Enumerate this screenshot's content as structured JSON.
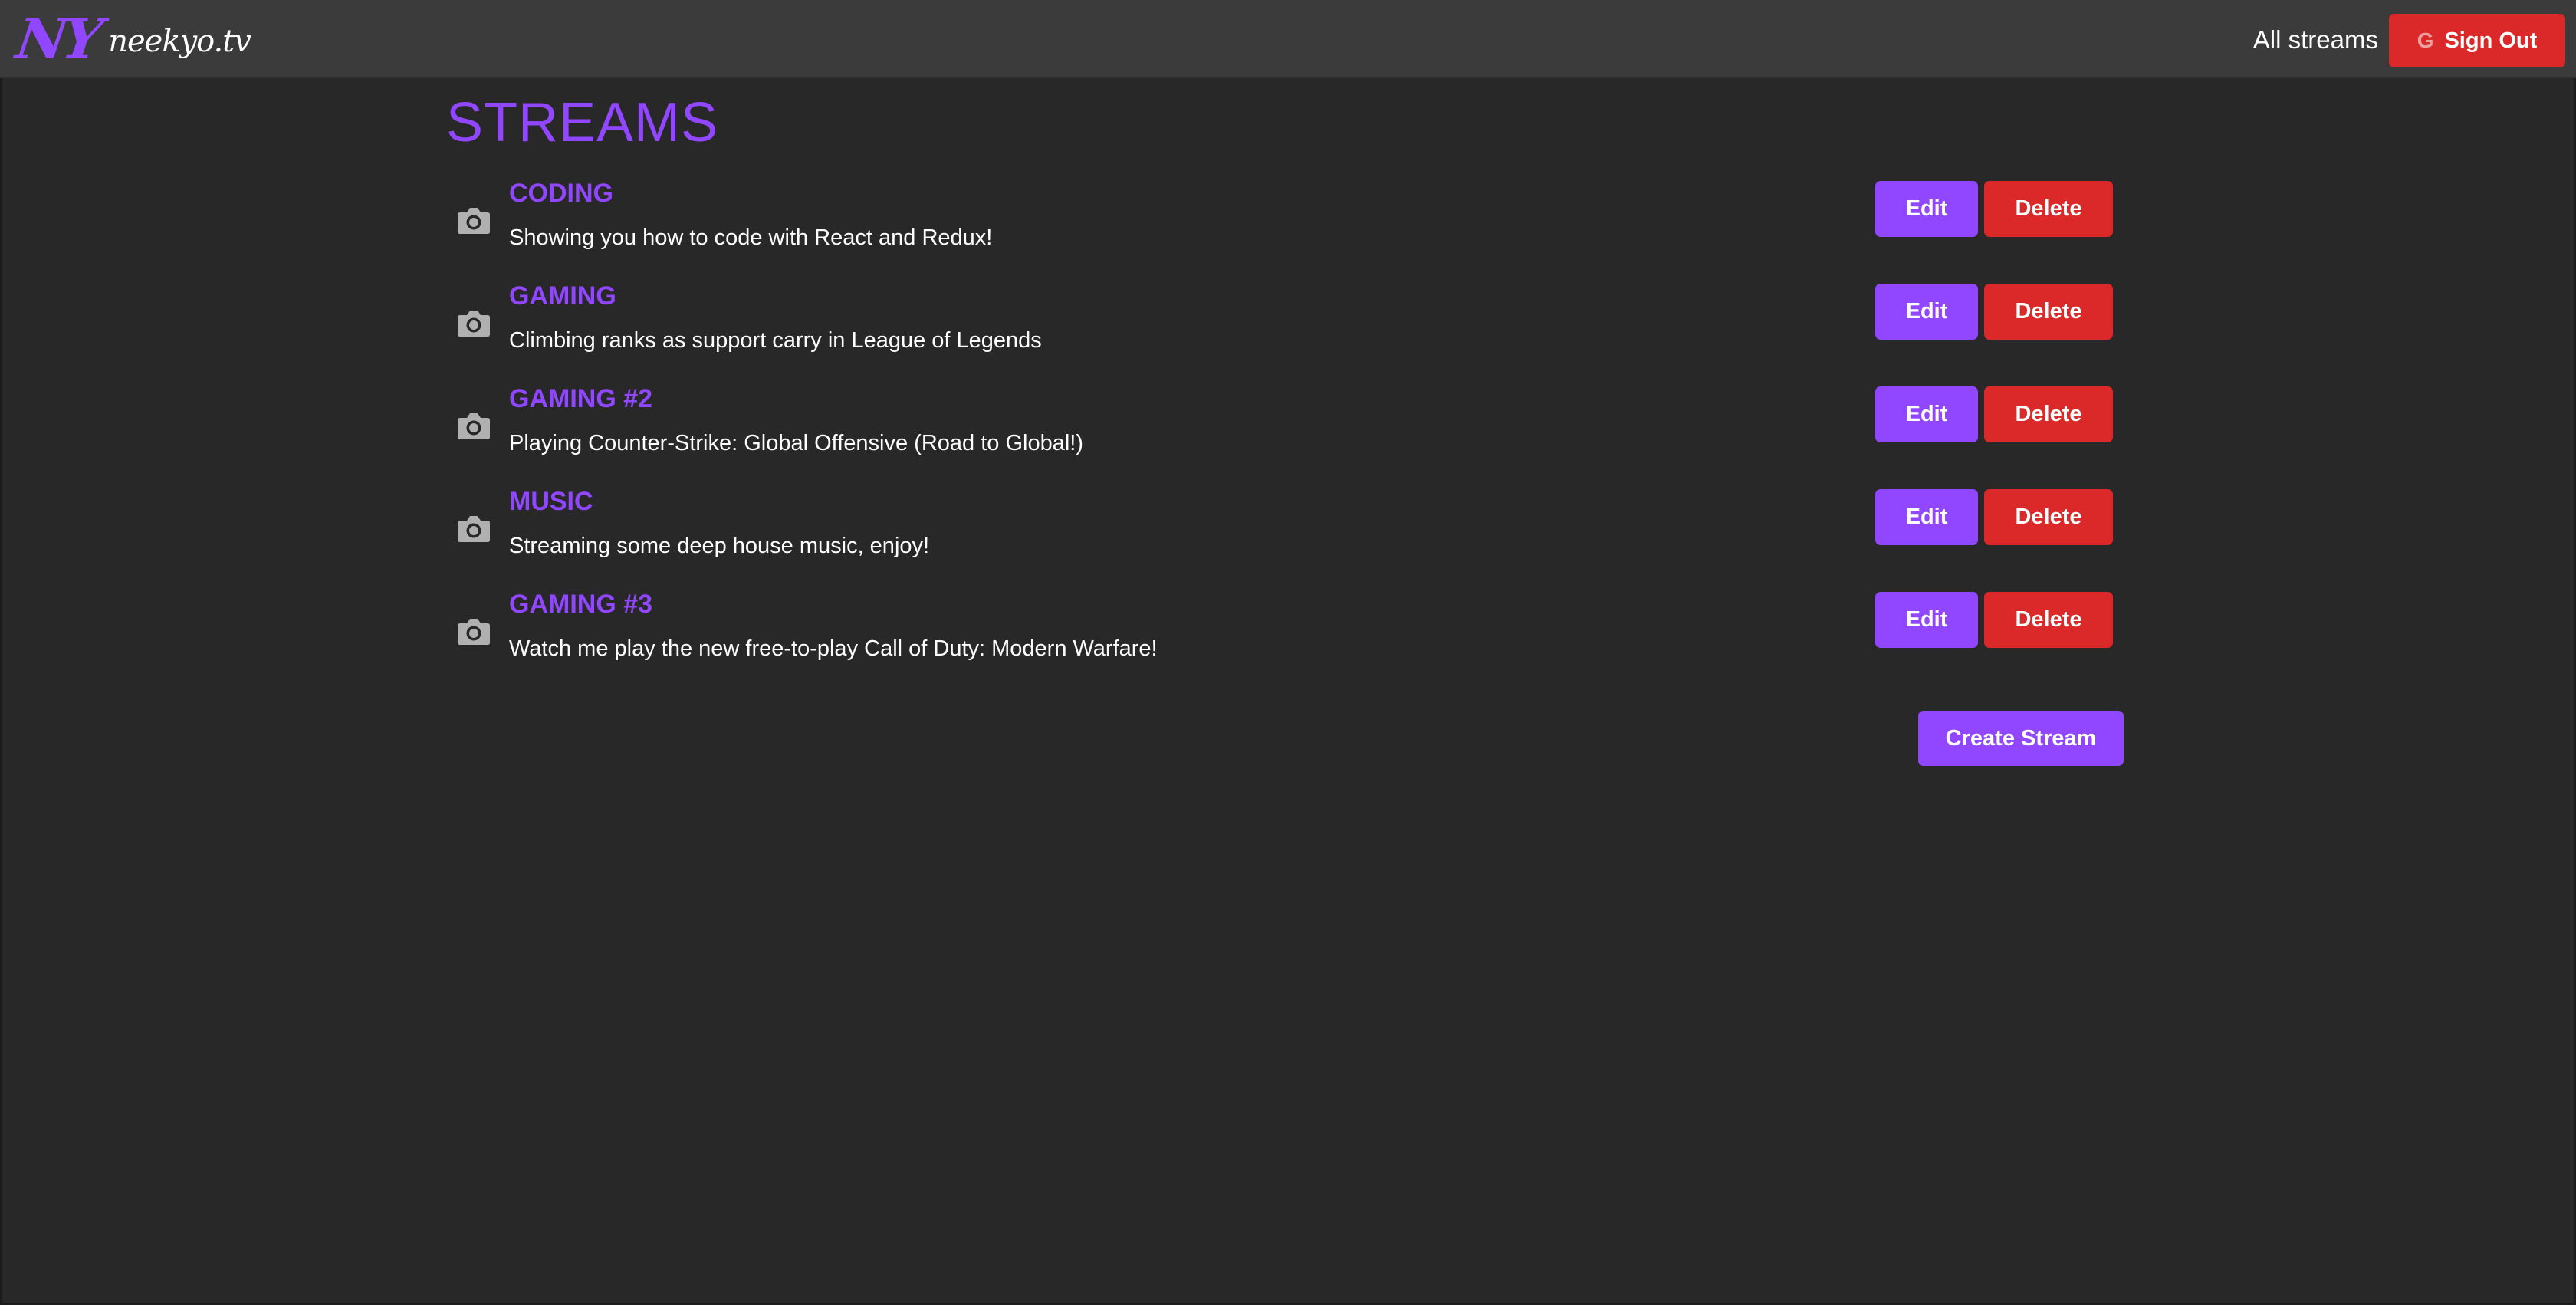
{
  "brand": {
    "mark": "NY",
    "name": "neekyo.tv"
  },
  "header": {
    "all_streams_link": "All streams",
    "sign_out_label": "Sign Out",
    "sign_out_icon": "google-icon"
  },
  "page": {
    "title": "STREAMS"
  },
  "streams": [
    {
      "title": "CODING",
      "description": "Showing you how to code with React and Redux!",
      "icon": "camera-icon",
      "edit_label": "Edit",
      "delete_label": "Delete"
    },
    {
      "title": "GAMING",
      "description": "Climbing ranks as support carry in League of Legends",
      "icon": "camera-icon",
      "edit_label": "Edit",
      "delete_label": "Delete"
    },
    {
      "title": "GAMING #2",
      "description": "Playing Counter-Strike: Global Offensive (Road to Global!)",
      "icon": "camera-icon",
      "edit_label": "Edit",
      "delete_label": "Delete"
    },
    {
      "title": "MUSIC",
      "description": "Streaming some deep house music, enjoy!",
      "icon": "camera-icon",
      "edit_label": "Edit",
      "delete_label": "Delete"
    },
    {
      "title": "GAMING #3",
      "description": "Watch me play the new free-to-play Call of Duty: Modern Warfare!",
      "icon": "camera-icon",
      "edit_label": "Edit",
      "delete_label": "Delete"
    }
  ],
  "actions": {
    "create_stream_label": "Create Stream"
  },
  "colors": {
    "background": "#282828",
    "header": "#3b3b3c",
    "accent_purple": "#9147ff",
    "danger_red": "#db2828",
    "icon_gray": "#b0b0b0"
  }
}
